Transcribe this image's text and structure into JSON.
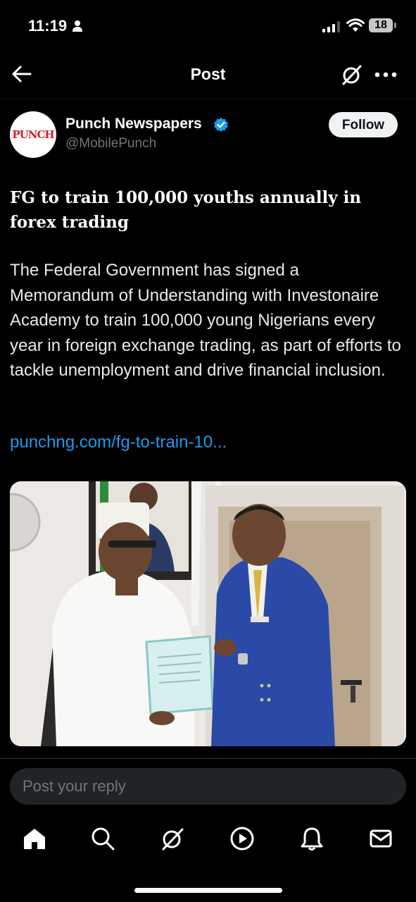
{
  "status_bar": {
    "time": "11:19",
    "battery": "18"
  },
  "header": {
    "title": "Post"
  },
  "author": {
    "avatar_text": "PUNCH",
    "name": "Punch Newspapers",
    "handle": "@MobilePunch",
    "follow_label": "Follow"
  },
  "post": {
    "headline": "FG to train 100,000 youths annually in forex trading",
    "body": "The Federal Government has signed a Memorandum of Understanding with Investonaire Academy to train 100,000 young Nigerians every year in foreign exchange trading, as part of efforts to tackle unemployment and drive financial inclusion.",
    "link": "punchng.com/fg-to-train-10..."
  },
  "reply": {
    "placeholder": "Post your reply"
  },
  "nav": [
    "home-icon",
    "search-icon",
    "grok-icon",
    "video-icon",
    "notifications-icon",
    "messages-icon"
  ],
  "colors": {
    "accent": "#1d9bf0",
    "background": "#000000",
    "secondary_text": "#71767b"
  }
}
